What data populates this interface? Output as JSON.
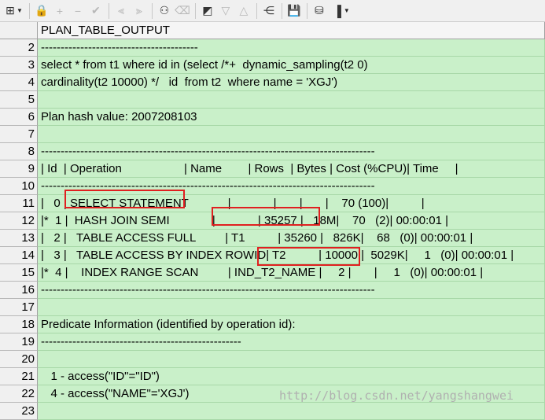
{
  "toolbar": {
    "buttons": [
      {
        "name": "grid-icon",
        "glyph": "⊞",
        "enabled": true
      },
      {
        "name": "lock-icon",
        "glyph": "🔒",
        "enabled": true
      },
      {
        "name": "plus-icon",
        "glyph": "+",
        "enabled": false
      },
      {
        "name": "minus-icon",
        "glyph": "−",
        "enabled": false
      },
      {
        "name": "check-icon",
        "glyph": "✔",
        "enabled": false
      },
      {
        "name": "filter-down-icon",
        "glyph": "⫷",
        "enabled": false
      },
      {
        "name": "filter-clear-icon",
        "glyph": "⫸",
        "enabled": false
      },
      {
        "name": "binoculars-icon",
        "glyph": "⚇",
        "enabled": true
      },
      {
        "name": "eraser-icon",
        "glyph": "⌫",
        "enabled": false
      },
      {
        "name": "fetch-icon",
        "glyph": "◩",
        "enabled": true
      },
      {
        "name": "triangle-down-icon",
        "glyph": "▽",
        "enabled": false
      },
      {
        "name": "triangle-up-icon",
        "glyph": "△",
        "enabled": false
      },
      {
        "name": "tree-icon",
        "glyph": "⋲",
        "enabled": true
      },
      {
        "name": "save-icon",
        "glyph": "💾",
        "enabled": true
      },
      {
        "name": "database-icon",
        "glyph": "⛁",
        "enabled": true
      },
      {
        "name": "chart-icon",
        "glyph": "▐",
        "enabled": true
      }
    ]
  },
  "grid": {
    "column_header": "PLAN_TABLE_OUTPUT",
    "rows": [
      {
        "num": "2",
        "text": "----------------------------------------"
      },
      {
        "num": "3",
        "text": "select * from t1 where id in (select /*+  dynamic_sampling(t2 0)"
      },
      {
        "num": "4",
        "text": "cardinality(t2 10000) */   id  from t2  where name = 'XGJ')"
      },
      {
        "num": "5",
        "text": ""
      },
      {
        "num": "6",
        "text": "Plan hash value: 2007208103"
      },
      {
        "num": "7",
        "text": ""
      },
      {
        "num": "8",
        "text": "-------------------------------------------------------------------------------------"
      },
      {
        "num": "9",
        "text": "| Id  | Operation                   | Name        | Rows  | Bytes | Cost (%CPU)| Time     |"
      },
      {
        "num": "10",
        "text": "-------------------------------------------------------------------------------------"
      },
      {
        "num": "11",
        "text": "|   0 | SELECT STATEMENT            |             |       |       |    70 (100)|          |"
      },
      {
        "num": "12",
        "text": "|*  1 |  HASH JOIN SEMI             |             | 35257 |   18M|    70   (2)| 00:00:01 |"
      },
      {
        "num": "13",
        "text": "|   2 |   TABLE ACCESS FULL         | T1          | 35260 |   826K|    68   (0)| 00:00:01 |"
      },
      {
        "num": "14",
        "text": "|   3 |   TABLE ACCESS BY INDEX ROWID| T2          | 10000 |  5029K|     1   (0)| 00:00:01 |"
      },
      {
        "num": "15",
        "text": "|*  4 |    INDEX RANGE SCAN         | IND_T2_NAME |     2 |       |     1   (0)| 00:00:01 |"
      },
      {
        "num": "16",
        "text": "-------------------------------------------------------------------------------------"
      },
      {
        "num": "17",
        "text": ""
      },
      {
        "num": "18",
        "text": "Predicate Information (identified by operation id):"
      },
      {
        "num": "19",
        "text": "---------------------------------------------------"
      },
      {
        "num": "20",
        "text": ""
      },
      {
        "num": "21",
        "text": "   1 - access(\"ID\"=\"ID\")"
      },
      {
        "num": "22",
        "text": "   4 - access(\"NAME\"='XGJ')"
      },
      {
        "num": "23",
        "text": ""
      }
    ]
  },
  "watermark": "http://blog.csdn.net/yangshangwei",
  "colors": {
    "cell_bg": "#c9f0c9",
    "highlight": "#e02020"
  }
}
